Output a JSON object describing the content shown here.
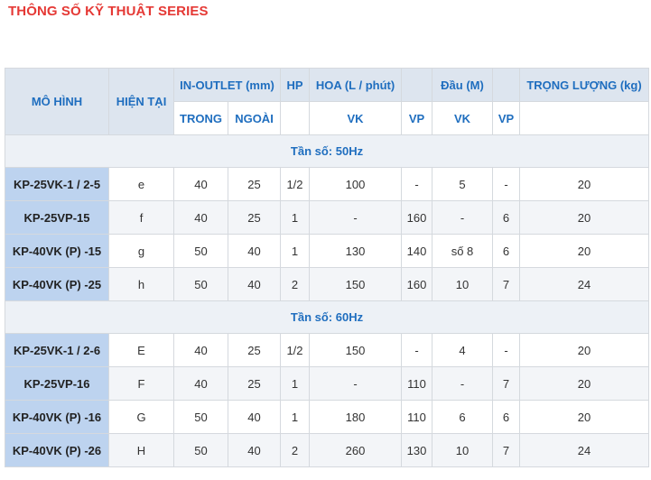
{
  "title": "THÔNG SỐ KỸ THUẬT SERIES",
  "headers": {
    "model": "MÔ HÌNH",
    "current": "HIỆN TẠI",
    "inout": "IN-OUTLET (mm)",
    "hp": "HP",
    "flow": "HOA (L / phút)",
    "blank": "",
    "head": "Đầu (M)",
    "weight": "TRỌNG LƯỢNG (kg)",
    "trong": "TRONG",
    "ngoai": "NGOÀI",
    "vk": "VK",
    "vp": "VP"
  },
  "sections": [
    {
      "label": "Tần số: 50Hz",
      "rows": [
        {
          "model": "KP-25VK-1 / 2-5",
          "current": "e",
          "in": "40",
          "out": "25",
          "hp": "1/2",
          "flow_vk": "100",
          "flow_vp": "-",
          "head_vk": "5",
          "head_vp": "-",
          "weight": "20"
        },
        {
          "model": "KP-25VP-15",
          "current": "f",
          "in": "40",
          "out": "25",
          "hp": "1",
          "flow_vk": "-",
          "flow_vp": "160",
          "head_vk": "-",
          "head_vp": "6",
          "weight": "20"
        },
        {
          "model": "KP-40VK (P) -15",
          "current": "g",
          "in": "50",
          "out": "40",
          "hp": "1",
          "flow_vk": "130",
          "flow_vp": "140",
          "head_vk": "số 8",
          "head_vp": "6",
          "weight": "20"
        },
        {
          "model": "KP-40VK (P) -25",
          "current": "h",
          "in": "50",
          "out": "40",
          "hp": "2",
          "flow_vk": "150",
          "flow_vp": "160",
          "head_vk": "10",
          "head_vp": "7",
          "weight": "24"
        }
      ]
    },
    {
      "label": "Tần số: 60Hz",
      "rows": [
        {
          "model": "KP-25VK-1 / 2-6",
          "current": "E",
          "in": "40",
          "out": "25",
          "hp": "1/2",
          "flow_vk": "150",
          "flow_vp": "-",
          "head_vk": "4",
          "head_vp": "-",
          "weight": "20"
        },
        {
          "model": "KP-25VP-16",
          "current": "F",
          "in": "40",
          "out": "25",
          "hp": "1",
          "flow_vk": "-",
          "flow_vp": "110",
          "head_vk": "-",
          "head_vp": "7",
          "weight": "20"
        },
        {
          "model": "KP-40VK (P) -16",
          "current": "G",
          "in": "50",
          "out": "40",
          "hp": "1",
          "flow_vk": "180",
          "flow_vp": "110",
          "head_vk": "6",
          "head_vp": "6",
          "weight": "20"
        },
        {
          "model": "KP-40VK (P) -26",
          "current": "H",
          "in": "50",
          "out": "40",
          "hp": "2",
          "flow_vk": "260",
          "flow_vp": "130",
          "head_vk": "10",
          "head_vp": "7",
          "weight": "24"
        }
      ]
    }
  ]
}
